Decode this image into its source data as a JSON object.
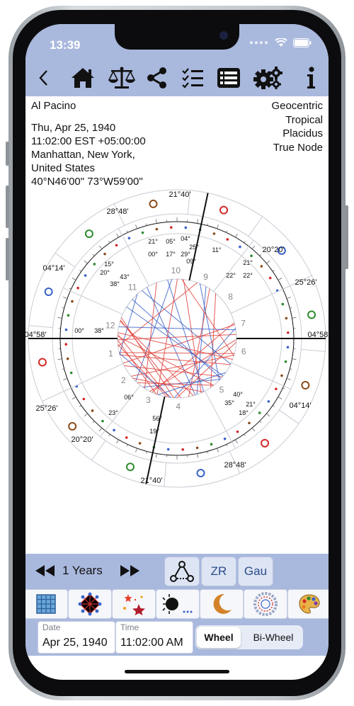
{
  "status": {
    "time": "13:39"
  },
  "info": {
    "name": "Al Pacino",
    "date_line": "Thu, Apr 25, 1940",
    "time_line": "11:02:00 EST +05:00:00",
    "place_line1": "Manhattan, New York,",
    "place_line2": "United States",
    "coords": "40°N46'00\" 73°W59'00\"",
    "settings": [
      "Geocentric",
      "Tropical",
      "Placidus",
      "True Node"
    ]
  },
  "toolbar_icons": [
    "back-chevron-icon",
    "home-icon",
    "scales-icon",
    "share-icon",
    "checklist-icon",
    "list-icon",
    "gears-icon",
    "info-icon"
  ],
  "wheel": {
    "house_numbers": [
      "1",
      "2",
      "3",
      "4",
      "5",
      "6",
      "7",
      "8",
      "9",
      "10",
      "11",
      "12"
    ],
    "cusp_degrees": {
      "top": "21°40'",
      "bottom": "21°40'",
      "left_asc": "04°58'",
      "right_dsc": "04°58'",
      "upper_left": "28°48'",
      "lower_right": "28°48'",
      "right_upper": "20°20'",
      "left_lower": "25°26'",
      "right_mid": "25°26'",
      "left_mid": "04°14'",
      "right_low": "04°14'",
      "lower_left": "20°20'"
    },
    "planet_labels": [
      "21°",
      "05°",
      "04°",
      "25°",
      "11°",
      "00°",
      "17°",
      "29°",
      "09°",
      "22°",
      "21°",
      "22°",
      "15°",
      "20°",
      "43°",
      "38°",
      "00°",
      "38°",
      "06°",
      "23°",
      "56°",
      "19°",
      "40°",
      "35°",
      "21°",
      "18°"
    ],
    "colors": {
      "red_aspect": "#e0403a",
      "blue_aspect": "#3a62c8",
      "fire": "#d62828",
      "water": "#3a62c8",
      "earth": "#8a4b1a",
      "air": "#2e8b2e"
    }
  },
  "controls": {
    "period": "1 Years",
    "zr_label": "ZR",
    "gau_label": "Gau",
    "date_label": "Date",
    "date_value": "Apr 25, 1940",
    "time_label": "Time",
    "time_value": "11:02:00 AM",
    "wheel_label": "Wheel",
    "biwheel_label": "Bi-Wheel"
  }
}
